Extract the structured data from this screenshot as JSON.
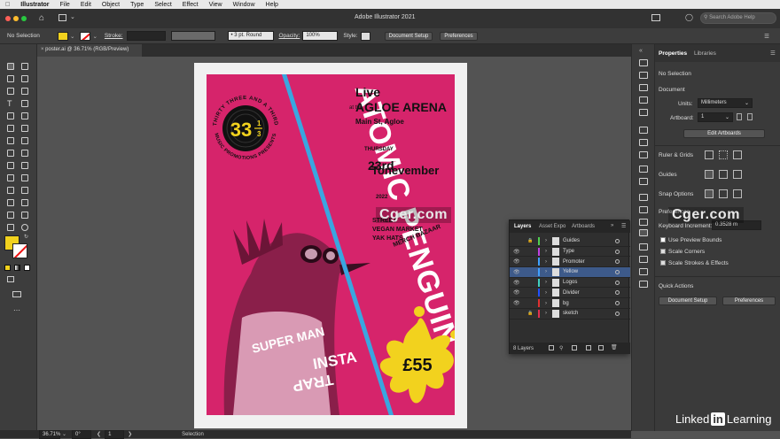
{
  "menubar": {
    "app": "Illustrator",
    "items": [
      "File",
      "Edit",
      "Object",
      "Type",
      "Select",
      "Effect",
      "View",
      "Window",
      "Help"
    ]
  },
  "app": {
    "title": "Adobe Illustrator 2021",
    "search_placeholder": "Search Adobe Help"
  },
  "control": {
    "selection": "No Selection",
    "stroke_label": "Stroke:",
    "brush": "3 pt. Round",
    "opacity_label": "Opacity:",
    "opacity": "100%",
    "style_label": "Style:",
    "doc_setup": "Document Setup",
    "preferences": "Preferences"
  },
  "doc_tab": {
    "name": "poster.ai @ 36.71% (RGB/Preview)"
  },
  "status": {
    "zoom": "36.71%",
    "rotation": "0°",
    "artboard": "1",
    "tool": "Selection"
  },
  "poster": {
    "badge_top": "THIRTY THREE AND A THIRD",
    "badge_num": "33",
    "badge_frac_num": "1",
    "badge_frac_den": "3",
    "badge_bottom": "MUSIC PROMOTIONS PRESENTS",
    "band": "ATOMIC PENGUIN",
    "live": "Live",
    "at": "at the",
    "venue": "AGLOE ARENA",
    "address": "Main St, Agloe",
    "day": "THURSDAY",
    "date": "23rd",
    "month": "Tonevember",
    "year": "2022",
    "extra1": "STREET",
    "extra2": "VEGAN MARKET",
    "extra3": "YAK HATS",
    "merch": "MERCH BAZAAR",
    "superman": "SUPER MAN",
    "insta": "INSTA",
    "trap": "TRAP",
    "price": "£55"
  },
  "layers_panel": {
    "tabs": [
      "Layers",
      "Asset Expo",
      "Artboards"
    ],
    "layers": [
      {
        "name": "Guides",
        "color": "#4fcf4f",
        "visible": false,
        "locked": true
      },
      {
        "name": "Type",
        "color": "#c040e0",
        "visible": true,
        "locked": false
      },
      {
        "name": "Promoter",
        "color": "#3fa0ff",
        "visible": true,
        "locked": false
      },
      {
        "name": "Yellow",
        "color": "#3fa0ff",
        "visible": true,
        "locked": false
      },
      {
        "name": "Logos",
        "color": "#40d0c0",
        "visible": true,
        "locked": false
      },
      {
        "name": "Divider",
        "color": "#2050ff",
        "visible": true,
        "locked": false
      },
      {
        "name": "bg",
        "color": "#e03030",
        "visible": true,
        "locked": false
      },
      {
        "name": "sketch",
        "color": "#e03050",
        "visible": false,
        "locked": true
      }
    ],
    "count": "8 Layers"
  },
  "properties_panel": {
    "tabs": [
      "Properties",
      "Libraries"
    ],
    "selection": "No Selection",
    "document": "Document",
    "units_label": "Units:",
    "units": "Millimeters",
    "artboard_label": "Artboard:",
    "artboard": "1",
    "edit_artboards": "Edit Artboards",
    "rulers": "Ruler & Grids",
    "guides": "Guides",
    "snap": "Snap Options",
    "preferences": "Preferences",
    "keyboard_label": "Keyboard Increment:",
    "keyboard_value": "0.3528 m",
    "use_preview_bounds": "Use Preview Bounds",
    "scale_corners": "Scale Corners",
    "scale_strokes": "Scale Strokes & Effects",
    "quick_actions": "Quick Actions",
    "qa_doc_setup": "Document Setup",
    "qa_preferences": "Preferences"
  },
  "watermarks": {
    "cger1": "Cger.com",
    "cger2": "Cger.com",
    "linkedin": "Linked",
    "linkedin_in": "in",
    "learning": "Learning"
  },
  "colors": {
    "poster_bg": "#d6246b",
    "divider": "#3aa6e0",
    "yellow": "#f2d21e",
    "fill_swatch": "#f2d21e"
  }
}
